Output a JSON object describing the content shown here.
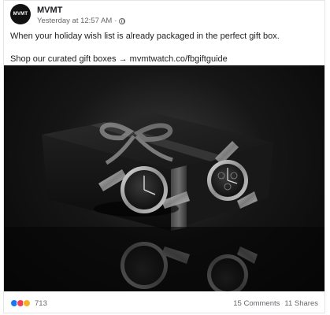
{
  "post": {
    "page_name": "MVMT",
    "avatar_text": "MVMT",
    "timestamp": "Yesterday at 12:57 AM",
    "separator": "·",
    "text": "When your holiday wish list is already packaged in the perfect gift box.",
    "link_prefix": "Shop our curated gift boxes",
    "link_arrow": "→",
    "link_url": "mvmtwatch.co/fbgiftguide"
  },
  "footer": {
    "reaction_count": "713",
    "comments": "15 Comments",
    "shares": "11 Shares"
  },
  "icons": {
    "privacy": "globe-icon",
    "reactions": [
      "like-icon",
      "love-icon",
      "wow-icon"
    ]
  },
  "colors": {
    "text": "#1c1e21",
    "meta": "#65676b",
    "like": "#1877f2",
    "love": "#f33e58",
    "wow": "#f7b125"
  }
}
